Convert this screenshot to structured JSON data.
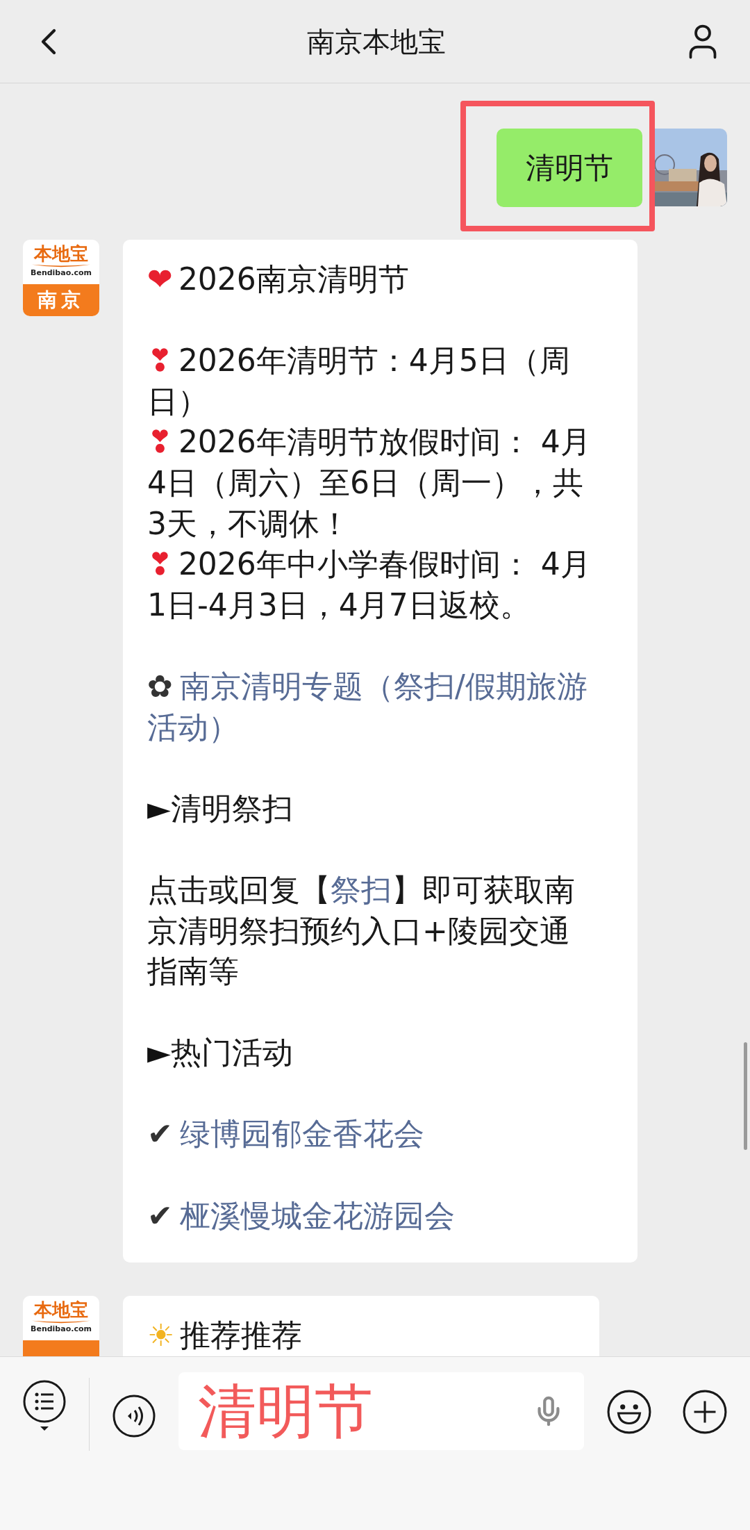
{
  "header": {
    "title": "南京本地宝"
  },
  "messages": [
    {
      "kind": "outgoing",
      "highlighted": true,
      "text": "清明节"
    },
    {
      "kind": "incoming",
      "avatar": {
        "brand": "本地宝",
        "domain": "Bendibao.com",
        "city": "南京"
      },
      "groups": [
        [
          {
            "emoji": "❤",
            "text": "2026南京清明节"
          }
        ],
        [
          {
            "emoji": "❣",
            "text": "2026年清明节：4月5日（周日）"
          },
          {
            "emoji": "❣",
            "text": "2026年清明节放假时间： 4月4日（周六）至6日（周一），共3天，不调休！"
          },
          {
            "emoji": "❣",
            "text": "2026年中小学春假时间： 4月1日-4月3日，4月7日返校。"
          }
        ],
        [
          {
            "bullet": "✿",
            "link": "南京清明专题（祭扫/假期旅游活动）"
          }
        ],
        [
          {
            "bullet": "►",
            "text": "清明祭扫"
          }
        ],
        [
          {
            "parts": [
              {
                "text": "点击或回复【"
              },
              {
                "link": "祭扫"
              },
              {
                "text": "】即可获取南京清明祭扫预约入口+陵园交通指南等"
              }
            ]
          }
        ],
        [
          {
            "bullet": "►",
            "text": "热门活动"
          }
        ],
        [
          {
            "bullet": "✔",
            "link": "绿博园郁金香花会"
          }
        ],
        [
          {
            "bullet": "✔",
            "link": "桠溪慢城金花游园会"
          }
        ]
      ]
    },
    {
      "kind": "incoming",
      "avatar": {
        "brand": "本地宝",
        "domain": "Bendibao.com"
      },
      "groups": [
        [
          {
            "emoji": "☀",
            "text": "推荐推荐"
          }
        ]
      ]
    }
  ],
  "input": {
    "value": "清明节"
  }
}
